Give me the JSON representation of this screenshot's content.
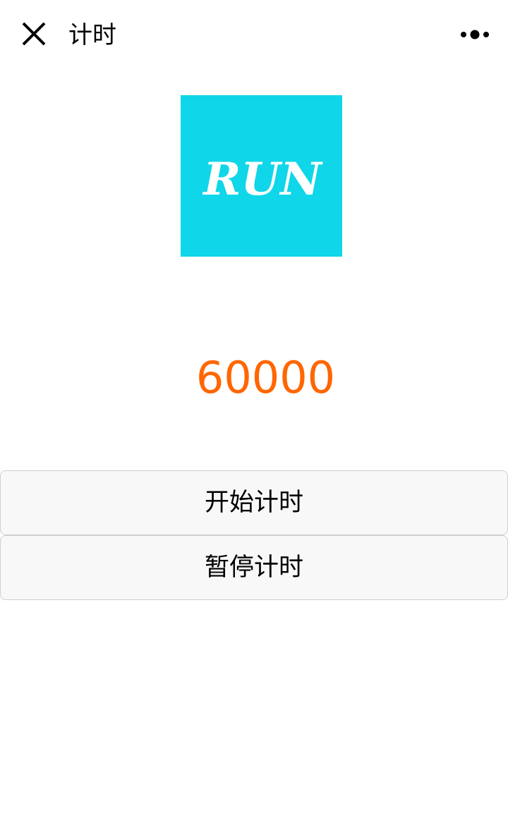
{
  "navbar": {
    "title": "计时",
    "close_icon": "close-icon",
    "more_icon": "more-dots-icon"
  },
  "logo": {
    "text": "RUN",
    "background_color": "#0fd6e8",
    "text_color": "#ffffff"
  },
  "timer": {
    "value": "60000",
    "color": "#ff6600"
  },
  "buttons": {
    "start_label": "开始计时",
    "pause_label": "暂停计时"
  }
}
